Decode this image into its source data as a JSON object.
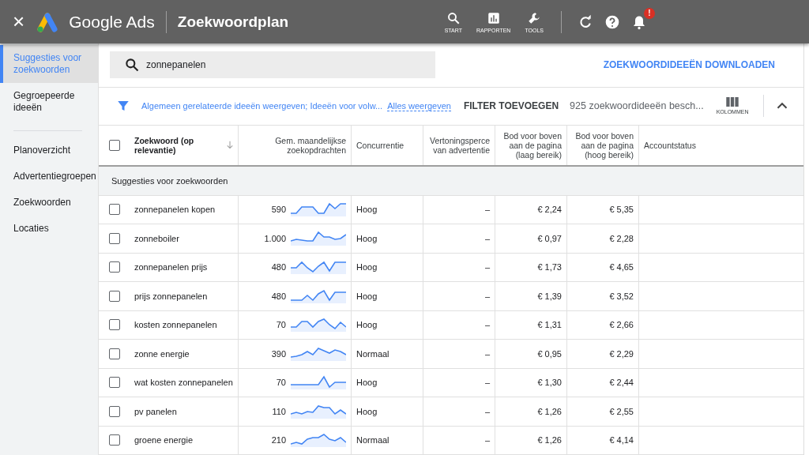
{
  "app": {
    "close": "×",
    "brand": "Google Ads",
    "title": "Zoekwoordplan"
  },
  "nav": [
    {
      "label": "START",
      "kind": "search"
    },
    {
      "label": "RAPPORTEN",
      "kind": "chart"
    },
    {
      "label": "TOOLS",
      "kind": "wrench"
    }
  ],
  "notification_badge": "!",
  "sidebar": [
    {
      "label": "Suggesties voor zoekwoorden",
      "selected": true
    },
    {
      "label": "Gegroepeerde ideeën",
      "selected": false
    },
    {
      "label": "Planoverzicht",
      "selected": false
    },
    {
      "label": "Advertentiegroepen",
      "selected": false
    },
    {
      "label": "Zoekwoorden",
      "selected": false
    },
    {
      "label": "Locaties",
      "selected": false
    }
  ],
  "search": {
    "value": "zonnepanelen"
  },
  "download": "ZOEKWOORDIDEEËN DOWNLOADEN",
  "filters": {
    "text": "Algemeen gerelateerde ideeën weergeven;  Ideeën voor volw...",
    "show_all": "Alles weergeven",
    "add_filter": "FILTER TOEVOEGEN",
    "count": "925 zoekwoordideeën besch...",
    "columns": "KOLOMMEN"
  },
  "table": {
    "columns": [
      "Zoekwoord (op relevantie)",
      "Gem. maandelijkse zoekopdrachten",
      "Concurrentie",
      "Vertoningsperce van advertentie",
      "Bod voor boven aan de pagina (laag bereik)",
      "Bod voor boven aan de pagina (hoog bereik)",
      "Accountstatus"
    ],
    "select_all_checked": false,
    "section": "Suggesties voor zoekwoorden",
    "rows": [
      {
        "keyword": "zonnepanelen kopen",
        "searches": "590",
        "competition": "Hoog",
        "share": "–",
        "low": "€ 2,24",
        "high": "€ 5,35",
        "checked": false
      },
      {
        "keyword": "zonneboiler",
        "searches": "1.000",
        "competition": "Hoog",
        "share": "–",
        "low": "€ 0,97",
        "high": "€ 2,28",
        "checked": false
      },
      {
        "keyword": "zonnepanelen prijs",
        "searches": "480",
        "competition": "Hoog",
        "share": "–",
        "low": "€ 1,73",
        "high": "€ 4,65",
        "checked": false
      },
      {
        "keyword": "prijs zonnepanelen",
        "searches": "480",
        "competition": "Hoog",
        "share": "–",
        "low": "€ 1,39",
        "high": "€ 3,52",
        "checked": false
      },
      {
        "keyword": "kosten zonnepanelen",
        "searches": "70",
        "competition": "Hoog",
        "share": "–",
        "low": "€ 1,31",
        "high": "€ 2,66",
        "checked": false
      },
      {
        "keyword": "zonne energie",
        "searches": "390",
        "competition": "Normaal",
        "share": "–",
        "low": "€ 0,95",
        "high": "€ 2,29",
        "checked": false
      },
      {
        "keyword": "wat kosten zonnepanelen",
        "searches": "70",
        "competition": "Hoog",
        "share": "–",
        "low": "€ 1,30",
        "high": "€ 2,44",
        "checked": false
      },
      {
        "keyword": "pv panelen",
        "searches": "110",
        "competition": "Hoog",
        "share": "–",
        "low": "€ 1,26",
        "high": "€ 2,55",
        "checked": false
      },
      {
        "keyword": "groene energie",
        "searches": "210",
        "competition": "Normaal",
        "share": "–",
        "low": "€ 1,26",
        "high": "€ 4,14",
        "checked": false
      }
    ]
  }
}
